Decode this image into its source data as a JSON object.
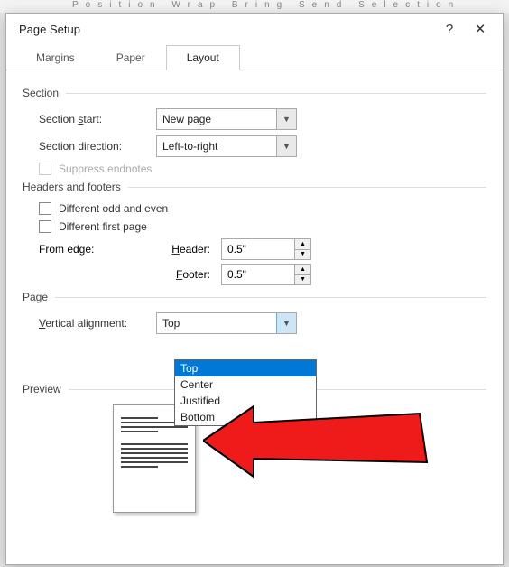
{
  "dialog": {
    "title": "Page Setup",
    "help": "?",
    "close": "✕"
  },
  "tabs": {
    "margins": "Margins",
    "paper": "Paper",
    "layout": "Layout"
  },
  "section": {
    "group": "Section",
    "start_label_pre": "Section ",
    "start_label_u": "s",
    "start_label_post": "tart:",
    "start_value": "New page",
    "direction_label": "Section direction:",
    "direction_value": "Left-to-right",
    "suppress": "Suppress endnotes"
  },
  "hf": {
    "group": "Headers and footers",
    "odd_even": "Different odd and even",
    "first_page": "Different first page",
    "from_edge": "From edge:",
    "header_label_u": "H",
    "header_label_post": "eader:",
    "footer_label_u": "F",
    "footer_label_post": "ooter:",
    "header_value": "0.5\"",
    "footer_value": "0.5\""
  },
  "page": {
    "group": "Page",
    "valign_label_u": "V",
    "valign_label_post": "ertical alignment:",
    "valign_value": "Top",
    "options": [
      "Top",
      "Center",
      "Justified",
      "Bottom"
    ]
  },
  "preview": {
    "group": "Preview"
  },
  "ribbon": "Position  Wrap   Bring    Send   Selection"
}
